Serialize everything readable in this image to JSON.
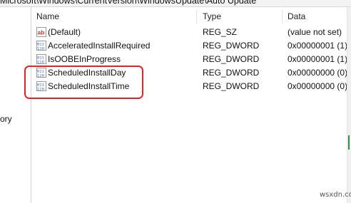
{
  "window": {
    "address_path": "Microsoft\\Windows\\CurrentVersion\\WindowsUpdate\\Auto Update",
    "tree_fragment": "ory"
  },
  "columns": {
    "name": "Name",
    "type": "Type",
    "data": "Data"
  },
  "values": [
    {
      "name": "(Default)",
      "type": "REG_SZ",
      "data": "(value not set)",
      "icon": "string-value-icon"
    },
    {
      "name": "AcceleratedInstallRequired",
      "type": "REG_DWORD",
      "data": "0x00000001 (1)",
      "icon": "binary-value-icon"
    },
    {
      "name": "IsOOBEInProgress",
      "type": "REG_DWORD",
      "data": "0x00000001 (1)",
      "icon": "binary-value-icon"
    },
    {
      "name": "ScheduledInstallDay",
      "type": "REG_DWORD",
      "data": "0x00000000 (0)",
      "icon": "binary-value-icon"
    },
    {
      "name": "ScheduledInstallTime",
      "type": "REG_DWORD",
      "data": "0x00000000 (0)",
      "icon": "binary-value-icon"
    }
  ],
  "annotation": {
    "color": "#e0262a",
    "highlighted": [
      "ScheduledInstallDay",
      "ScheduledInstallTime"
    ]
  },
  "watermark": "wsxdn.com"
}
